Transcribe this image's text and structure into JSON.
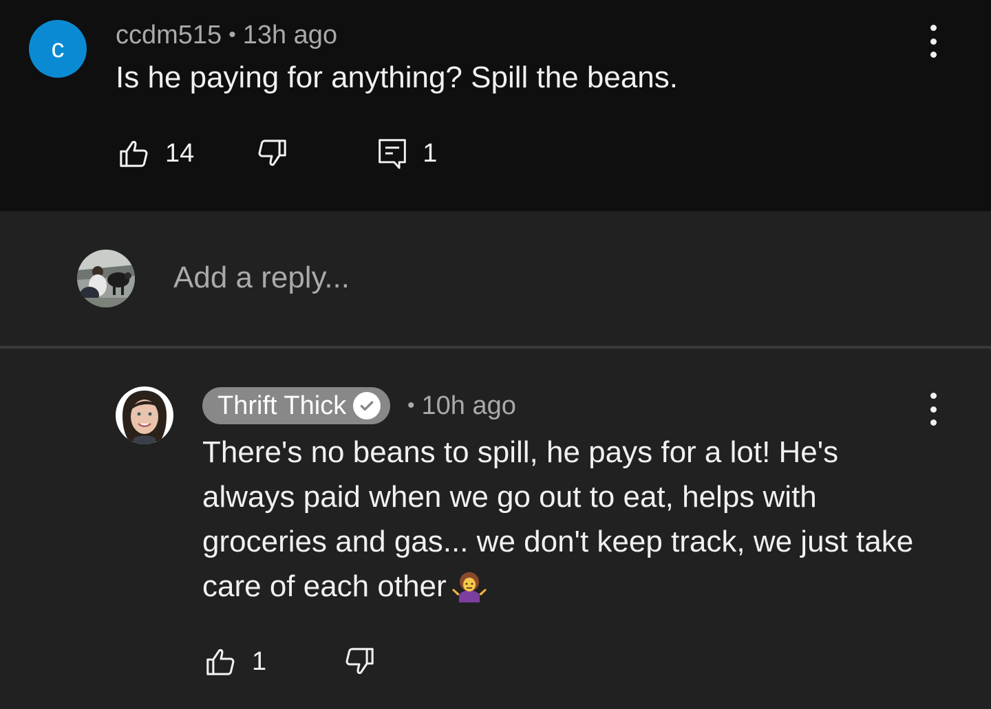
{
  "top_comment": {
    "avatar_letter": "c",
    "username": "ccdm515",
    "separator": "•",
    "time": "13h ago",
    "text": "Is he paying for anything? Spill the beans.",
    "likes": "14",
    "replies": "1"
  },
  "reply_box": {
    "placeholder": "Add a reply..."
  },
  "reply_comment": {
    "author": "Thrift Thick",
    "separator": "•",
    "time": "10h ago",
    "text": "There's no beans to spill, he pays for a lot! He's always paid when we go out to eat, helps with groceries and gas... we don't keep track, we just take care of each other",
    "likes": "1"
  },
  "colors": {
    "top_background": "#0f0f0f",
    "page_background": "#212121",
    "avatar_blue": "#0b8ad4",
    "author_pill": "#888888",
    "secondary_text": "#aaaaaa"
  },
  "icons": [
    "thumbs-up-icon",
    "thumbs-down-icon",
    "reply-comment-icon",
    "more-vert-icon",
    "verified-check-icon",
    "shrug-emoji-icon"
  ]
}
